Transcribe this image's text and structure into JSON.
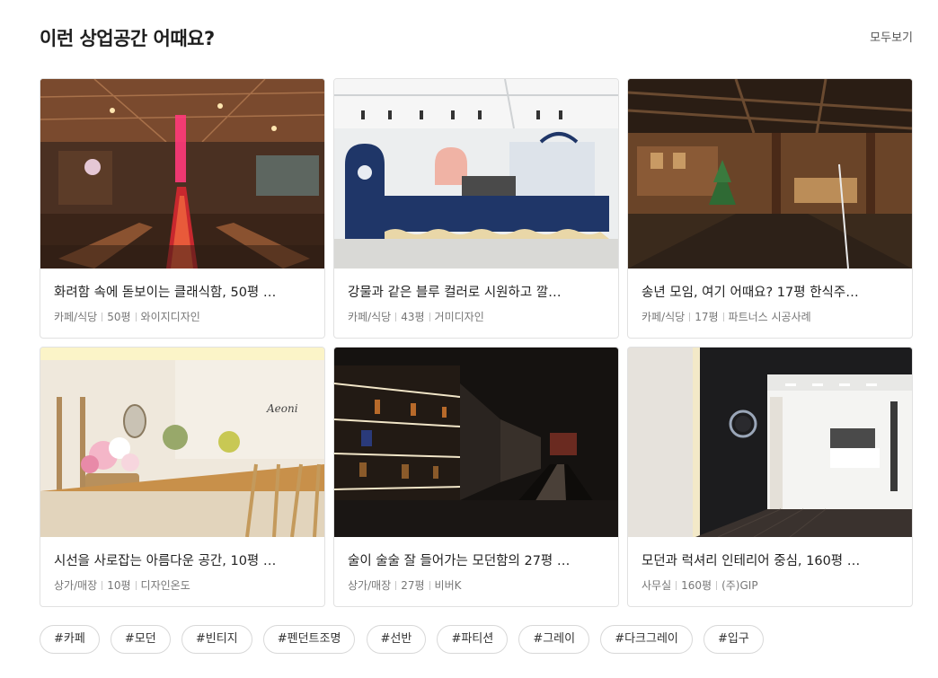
{
  "section": {
    "title": "이런 상업공간 어때요?",
    "see_all": "모두보기"
  },
  "cards": [
    {
      "title": "화려함 속에 돋보이는 클래식함, 50평 …",
      "category": "카페/식당",
      "size": "50평",
      "designer": "와이지디자인"
    },
    {
      "title": "강물과 같은 블루 컬러로 시원하고 깔…",
      "category": "카페/식당",
      "size": "43평",
      "designer": "거미디자인"
    },
    {
      "title": "송년 모임, 여기 어때요? 17평 한식주…",
      "category": "카페/식당",
      "size": "17평",
      "designer": "파트너스 시공사례"
    },
    {
      "title": "시선을 사로잡는 아름다운 공간, 10평 …",
      "category": "상가/매장",
      "size": "10평",
      "designer": "디자인온도"
    },
    {
      "title": "술이 술술 잘 들어가는 모던함의 27평 …",
      "category": "상가/매장",
      "size": "27평",
      "designer": "비버K"
    },
    {
      "title": "모던과 럭셔리 인테리어 중심, 160평 …",
      "category": "사무실",
      "size": "160평",
      "designer": "(주)GIP"
    }
  ],
  "image_labels": {
    "aeoni_sign": "Aeoni"
  },
  "tags": [
    "#카페",
    "#모던",
    "#빈티지",
    "#펜던트조명",
    "#선반",
    "#파티션",
    "#그레이",
    "#다크그레이",
    "#입구"
  ]
}
